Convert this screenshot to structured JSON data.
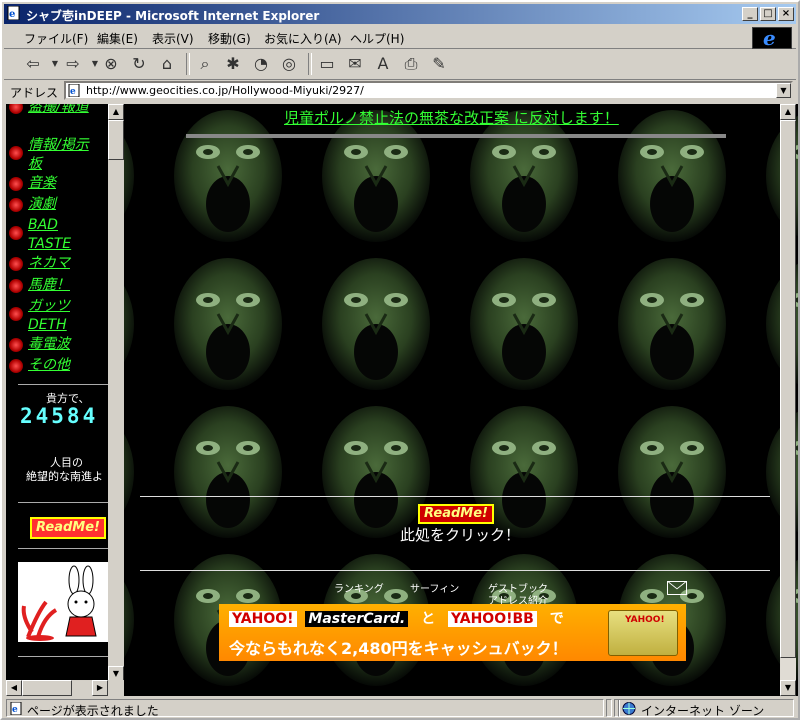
{
  "window": {
    "title": "シャブ壱inDEEP - Microsoft Internet Explorer",
    "controls": [
      "_",
      "□",
      "×"
    ]
  },
  "menu": [
    "ファイル(F)",
    "編集(E)",
    "表示(V)",
    "移動(G)",
    "お気に入り(A)",
    "ヘルプ(H)"
  ],
  "address": {
    "label": "アドレス",
    "url": "http://www.geocities.co.jp/Hollywood-Miyuki/2927/"
  },
  "left_nav": {
    "items": [
      "盗撮/報道",
      "情報/掲示板",
      "音楽",
      "演劇",
      "BAD TASTE",
      "ネカマ",
      "馬鹿！",
      "ガッツDETH",
      "毒電波",
      "その他"
    ],
    "counter_label": "貴方で、",
    "counter_value": "24584",
    "caption_line1": "人目の",
    "caption_line2": "絶望的な南進よ",
    "readme_label": "ReadMe!"
  },
  "main": {
    "top_banner": "児童ポルノ禁止法の無茶な改正案 に反対します！",
    "readme_label": "ReadMe!",
    "click_text": "此処をクリック！",
    "footer_links": [
      "ランキング",
      "サーフィン",
      "ゲストブック",
      "アドレス紹介"
    ]
  },
  "ad": {
    "row1_a": "YAHOO!",
    "row1_b": "MasterCard.",
    "row1_c": "と",
    "row1_d": "YAHOO!BB",
    "row1_e": "で",
    "row2": "今ならもれなく2,480円をキャッシュバック！",
    "card_text": "YAHOO!"
  },
  "status": {
    "text": "ページが表示されました",
    "zone": "インターネット ゾーン"
  }
}
